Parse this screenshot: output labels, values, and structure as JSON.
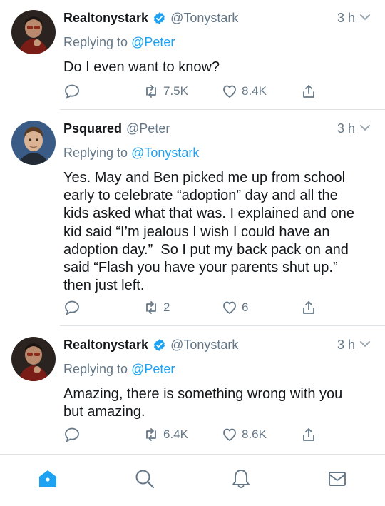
{
  "tweets": [
    {
      "name": "Realtonystark",
      "verified": true,
      "handle": "@Tonystark",
      "time": "3 h",
      "replying_prefix": "Replying to ",
      "replying_to": "@Peter",
      "body": "Do I even want to know?",
      "retweets": "7.5K",
      "likes": "8.4K"
    },
    {
      "name": "Psquared",
      "verified": false,
      "handle": "@Peter",
      "time": "3 h",
      "replying_prefix": "Replying to ",
      "replying_to": "@Tonystark",
      "body": "Yes. May and Ben picked me up from school early to celebrate “adoption” day and all the kids asked what that was. I explained and one kid said “I’m jealous I wish I could have an adoption day.”  So I put my back pack on and said “Flash you have your parents shut up.” then just left.",
      "retweets": "2",
      "likes": "6"
    },
    {
      "name": "Realtonystark",
      "verified": true,
      "handle": "@Tonystark",
      "time": "3 h",
      "replying_prefix": "Replying to ",
      "replying_to": "@Peter",
      "body": "Amazing, there is something wrong with you but amazing.",
      "retweets": "6.4K",
      "likes": "8.6K"
    }
  ],
  "icons": {
    "reply": "reply-icon",
    "retweet": "retweet-icon",
    "like": "heart-icon",
    "share": "share-icon",
    "verified": "verified-badge-icon",
    "menu": "chevron-down-icon",
    "home": "home-icon",
    "search": "search-icon",
    "notifications": "bell-icon",
    "messages": "mail-icon"
  },
  "colors": {
    "accent": "#1da1f2",
    "secondary_text": "#657786",
    "divider": "#dfe3e6"
  }
}
